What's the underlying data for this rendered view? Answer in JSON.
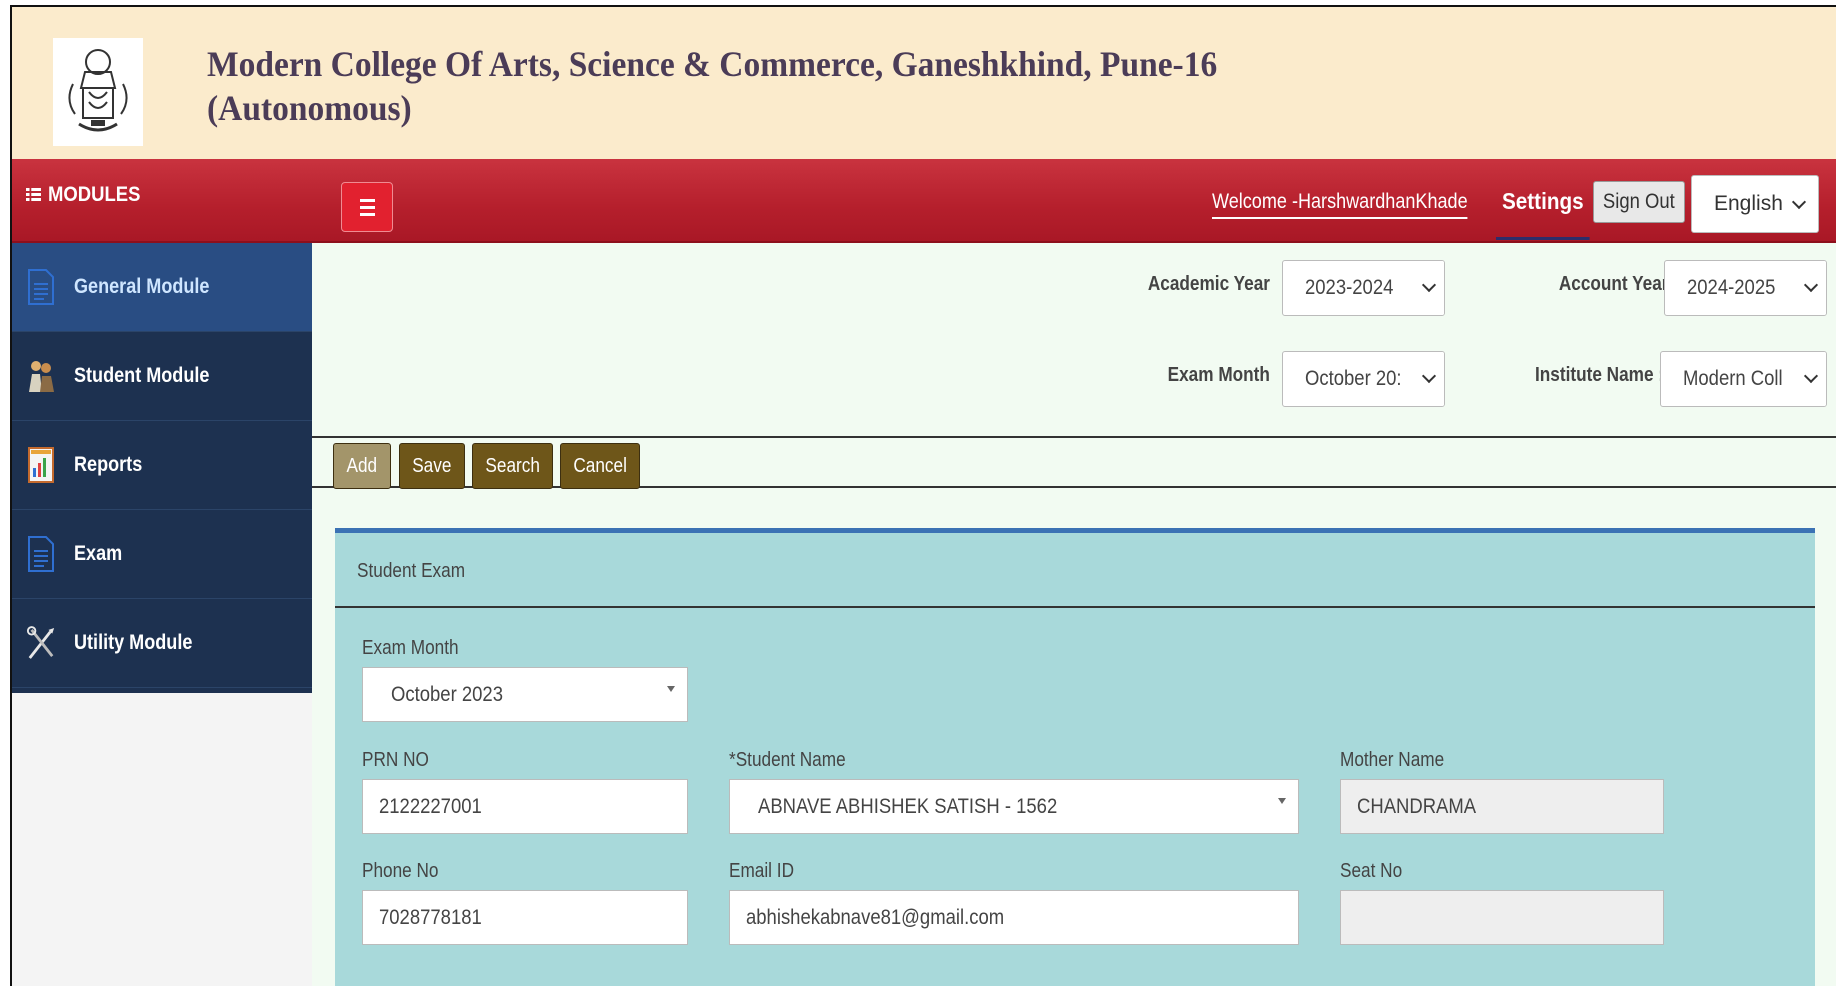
{
  "header": {
    "college_title_line1": "Modern College Of Arts, Science & Commerce, Ganeshkhind, Pune-16",
    "college_title_line2": "(Autonomous)"
  },
  "topnav": {
    "modules_label": "MODULES",
    "welcome_text": "Welcome -HarshwardhanKhade",
    "settings_label": "Settings",
    "signout_label": "Sign Out",
    "language": "English"
  },
  "sidebar": {
    "items": [
      {
        "label": "General Module",
        "icon": "document-icon",
        "active": true
      },
      {
        "label": "Student Module",
        "icon": "students-icon",
        "active": false
      },
      {
        "label": "Reports",
        "icon": "report-icon",
        "active": false
      },
      {
        "label": "Exam",
        "icon": "document-icon",
        "active": false
      },
      {
        "label": "Utility Module",
        "icon": "tools-icon",
        "active": false
      }
    ]
  },
  "filters": {
    "academic_year_label": "Academic Year",
    "academic_year_value": "2023-2024",
    "account_year_label": "Account Year",
    "account_year_value": "2024-2025",
    "exam_month_label": "Exam Month",
    "exam_month_value": "October 20:",
    "institute_name_label": "Institute Name :",
    "institute_name_value": "Modern Coll"
  },
  "toolbar": {
    "add_label": "Add",
    "save_label": "Save",
    "search_label": "Search",
    "cancel_label": "Cancel"
  },
  "form": {
    "panel_title": "Student Exam",
    "exam_month_label": "Exam Month",
    "exam_month_value": "October 2023",
    "prn_label": "PRN NO",
    "prn_value": "2122227001",
    "student_name_label": "*Student Name",
    "student_name_value": "ABNAVE ABHISHEK SATISH - 1562",
    "mother_name_label": "Mother Name",
    "mother_name_value": "CHANDRAMA",
    "phone_label": "Phone No",
    "phone_value": "7028778181",
    "email_label": "Email ID",
    "email_value": "abhishekabnave81@gmail.com",
    "seat_label": "Seat No",
    "seat_value": ""
  },
  "colors": {
    "header_bg": "#fbebcc",
    "nav_red": "#b51f2c",
    "sidebar_bg": "#1d3150",
    "panel_bg": "#a8d9da",
    "button_brown": "#6e5619"
  }
}
